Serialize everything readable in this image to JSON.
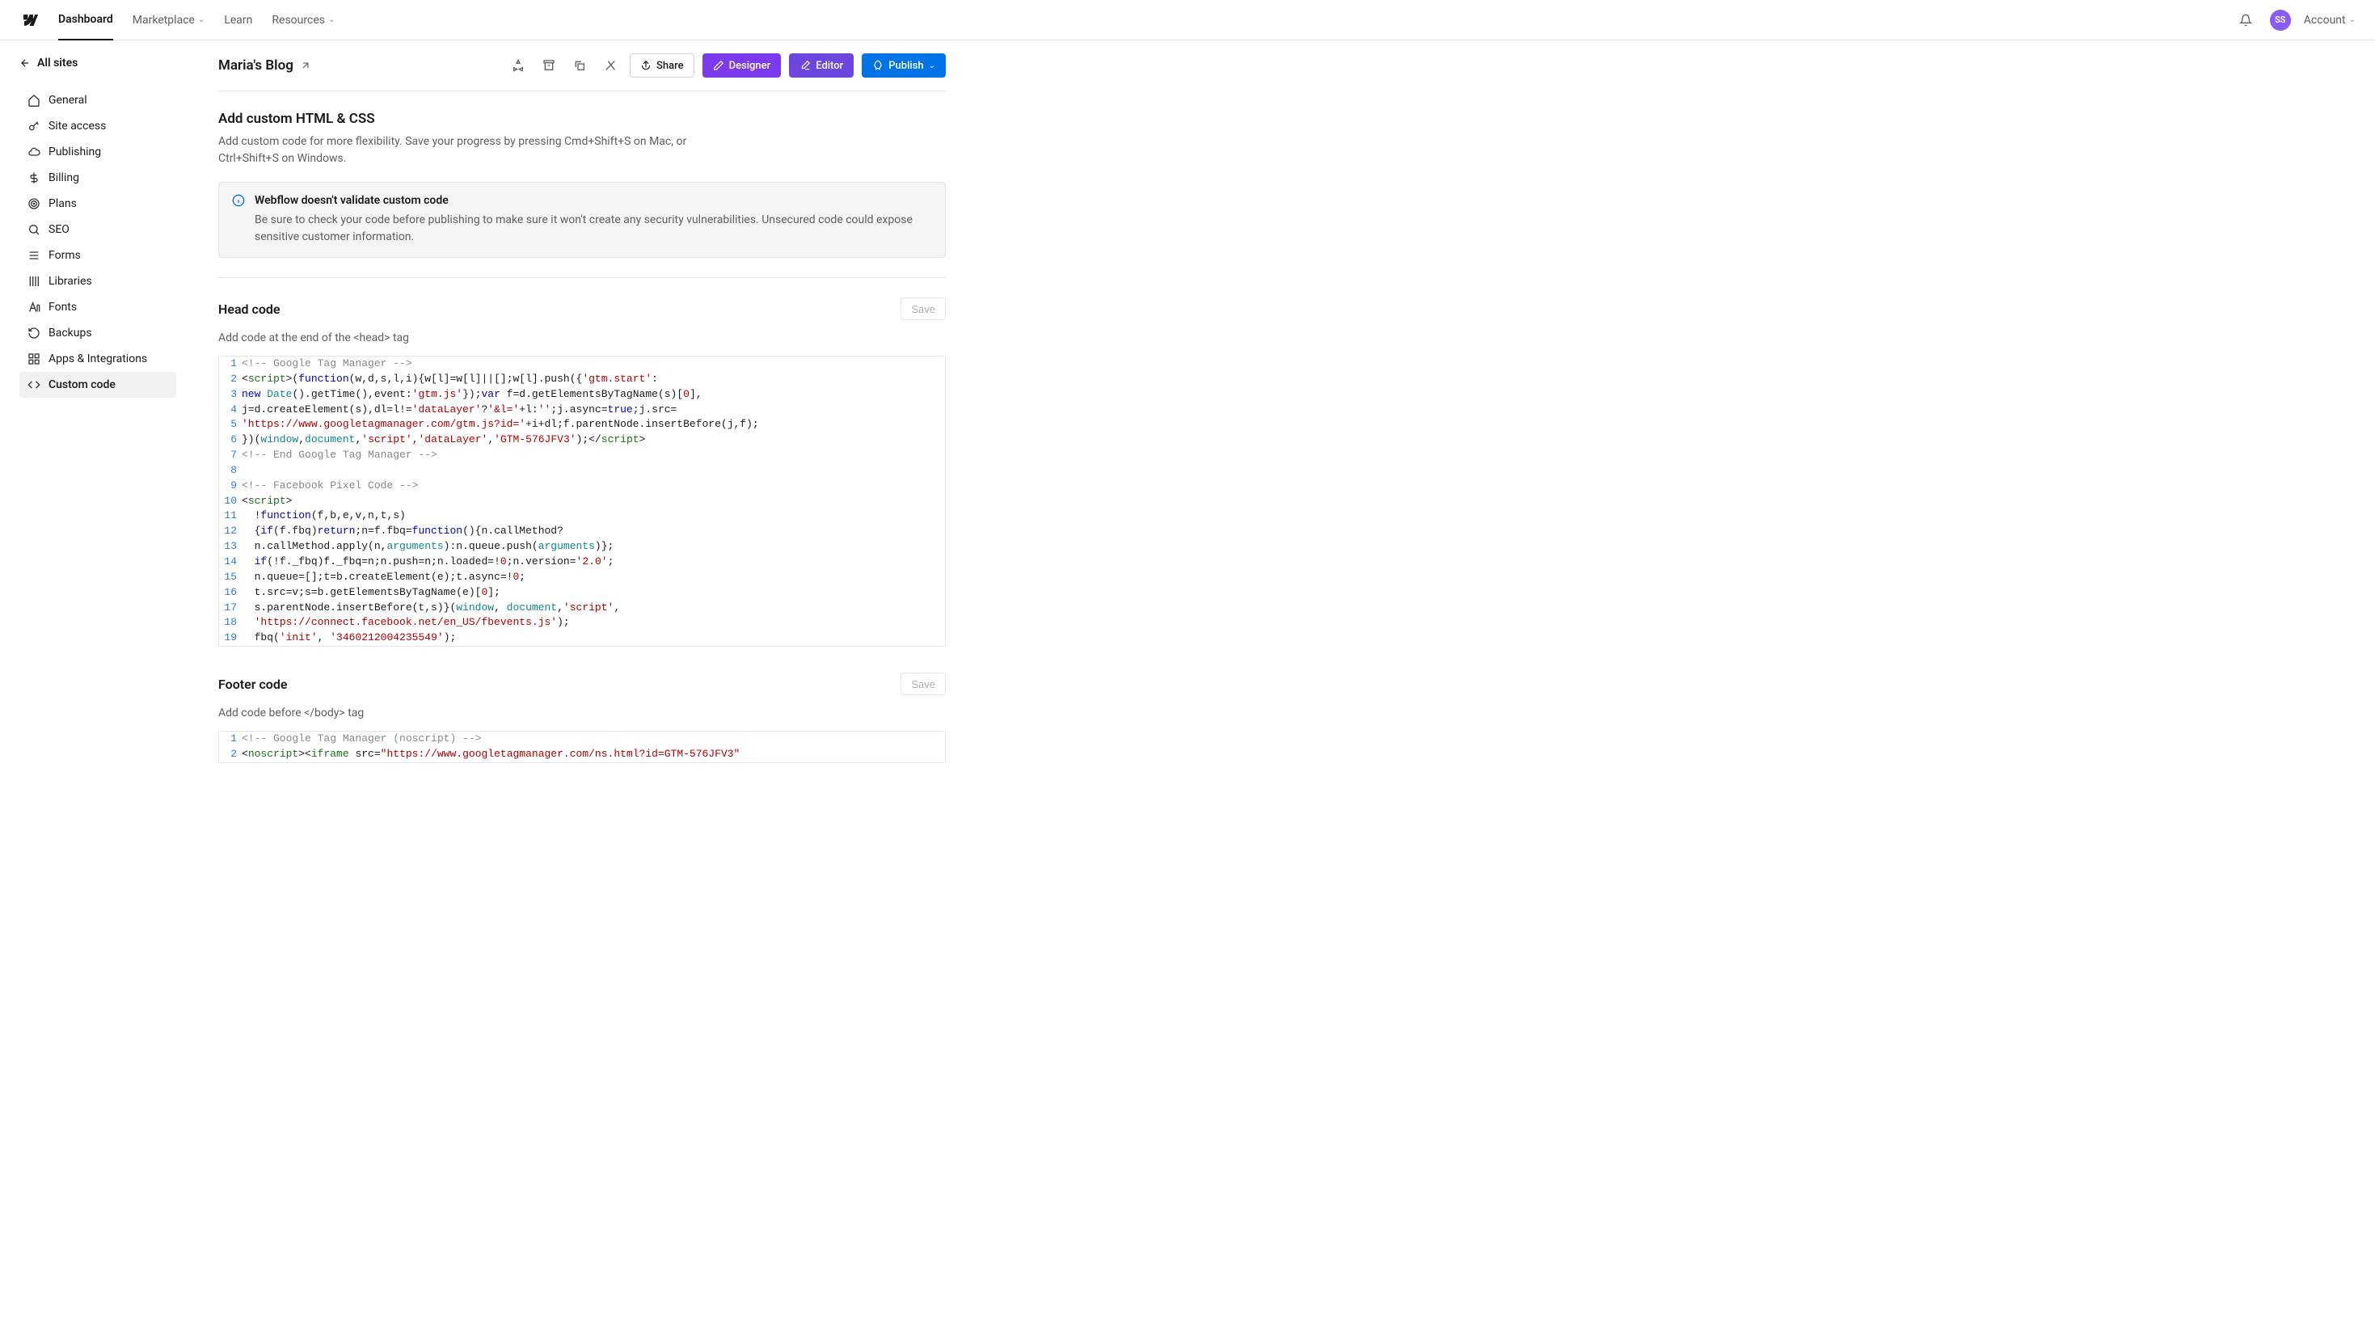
{
  "topnav": {
    "items": [
      "Dashboard",
      "Marketplace",
      "Learn",
      "Resources"
    ],
    "avatar_initials": "SS",
    "account_label": "Account"
  },
  "sidebar": {
    "back_label": "All sites",
    "items": [
      {
        "label": "General",
        "icon": "home"
      },
      {
        "label": "Site access",
        "icon": "key"
      },
      {
        "label": "Publishing",
        "icon": "cloud"
      },
      {
        "label": "Billing",
        "icon": "dollar"
      },
      {
        "label": "Plans",
        "icon": "target"
      },
      {
        "label": "SEO",
        "icon": "search"
      },
      {
        "label": "Forms",
        "icon": "list"
      },
      {
        "label": "Libraries",
        "icon": "books"
      },
      {
        "label": "Fonts",
        "icon": "font"
      },
      {
        "label": "Backups",
        "icon": "undo"
      },
      {
        "label": "Apps & Integrations",
        "icon": "grid"
      },
      {
        "label": "Custom code",
        "icon": "code"
      }
    ],
    "active_index": 11
  },
  "header": {
    "title": "Maria's Blog",
    "share_label": "Share",
    "designer_label": "Designer",
    "editor_label": "Editor",
    "publish_label": "Publish"
  },
  "custom_code": {
    "section_title": "Add custom HTML & CSS",
    "section_desc": "Add custom code for more flexibility. Save your progress by pressing Cmd+Shift+S on Mac, or Ctrl+Shift+S on Windows.",
    "alert_title": "Webflow doesn't validate custom code",
    "alert_body": "Be sure to check your code before publishing to make sure it won't create any security vulnerabilities. Unsecured code could expose sensitive customer information.",
    "head_title": "Head code",
    "head_desc": "Add code at the end of the <head> tag",
    "save_label": "Save",
    "footer_title": "Footer code",
    "footer_desc": "Add code before </body> tag"
  },
  "head_code_lines": [
    "<!-- Google Tag Manager -->",
    "<script>(function(w,d,s,l,i){w[l]=w[l]||[];w[l].push({'gtm.start':",
    "new Date().getTime(),event:'gtm.js'});var f=d.getElementsByTagName(s)[0],",
    "j=d.createElement(s),dl=l!='dataLayer'?'&l='+l:'';j.async=true;j.src=",
    "'https://www.googletagmanager.com/gtm.js?id='+i+dl;f.parentNode.insertBefore(j,f);",
    "})(window,document,'script','dataLayer','GTM-576JFV3');</script>",
    "<!-- End Google Tag Manager -->",
    "",
    "<!-- Facebook Pixel Code -->",
    "<script>",
    "  !function(f,b,e,v,n,t,s)",
    "  {if(f.fbq)return;n=f.fbq=function(){n.callMethod?",
    "  n.callMethod.apply(n,arguments):n.queue.push(arguments)};",
    "  if(!f._fbq)f._fbq=n;n.push=n;n.loaded=!0;n.version='2.0';",
    "  n.queue=[];t=b.createElement(e);t.async=!0;",
    "  t.src=v;s=b.getElementsByTagName(e)[0];",
    "  s.parentNode.insertBefore(t,s)}(window, document,'script',",
    "  'https://connect.facebook.net/en_US/fbevents.js');",
    "  fbq('init', '3460212004235549');"
  ],
  "footer_code_lines": [
    "<!-- Google Tag Manager (noscript) -->",
    "<noscript><iframe src=\"https://www.googletagmanager.com/ns.html?id=GTM-576JFV3\""
  ]
}
